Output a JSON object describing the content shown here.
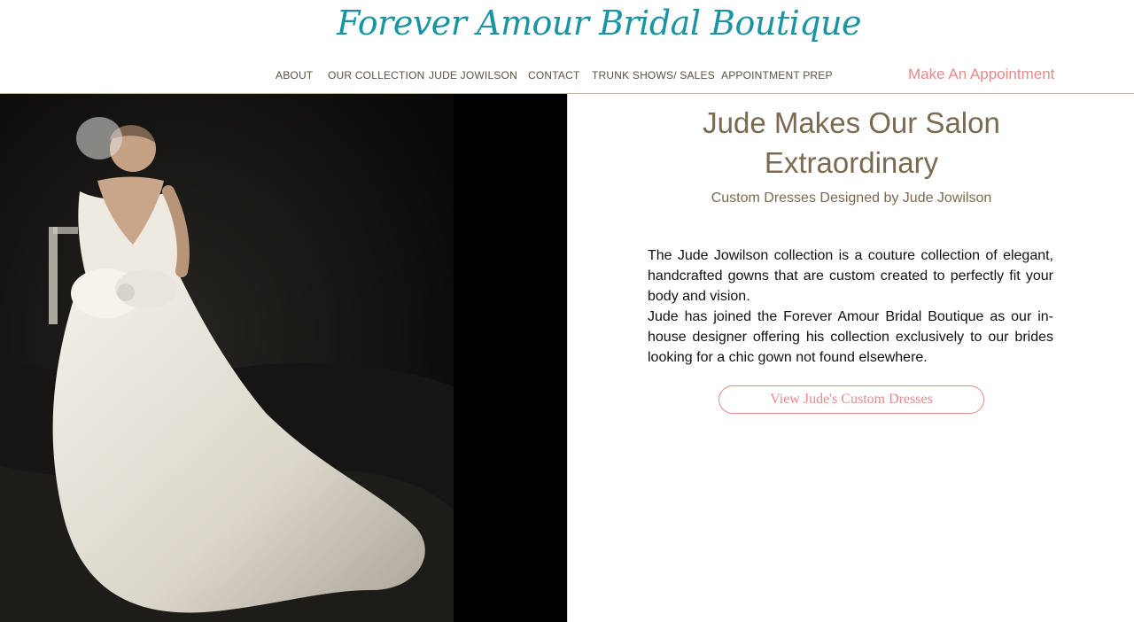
{
  "brand": {
    "logo_text": "Forever Amour Bridal Boutique",
    "colors": {
      "logo": "#1a93a3",
      "nav_text": "#5a5246",
      "appointment": "#e48b8b",
      "heading": "#7a6a52",
      "cta_text": "#e48b8b",
      "cta_border": "#e48b8b",
      "rule": "#c9b896"
    }
  },
  "nav": {
    "items": [
      {
        "label": "ABOUT"
      },
      {
        "label": "OUR COLLECTION"
      },
      {
        "label": "JUDE JOWILSON"
      },
      {
        "label": "CONTACT"
      },
      {
        "label": "TRUNK SHOWS/ SALES"
      },
      {
        "label": "APPOINTMENT PREP"
      }
    ],
    "appointment_label": "Make An Appointment"
  },
  "hero": {
    "image_icon": "bride-photo"
  },
  "content": {
    "title_line1": "Jude Makes Our Salon",
    "title_line2": "Extraordinary",
    "subtitle": "Custom Dresses Designed by Jude Jowilson",
    "paragraph1": "The Jude Jowilson collection is a couture collection of elegant, handcrafted gowns that are custom created to perfectly fit your body and vision.",
    "paragraph2": "Jude has joined the Forever Amour Bridal Boutique as our in-house designer offering his collection exclusively to our brides looking for a chic gown not found elsewhere.",
    "cta_label": "View Jude's Custom Dresses"
  }
}
